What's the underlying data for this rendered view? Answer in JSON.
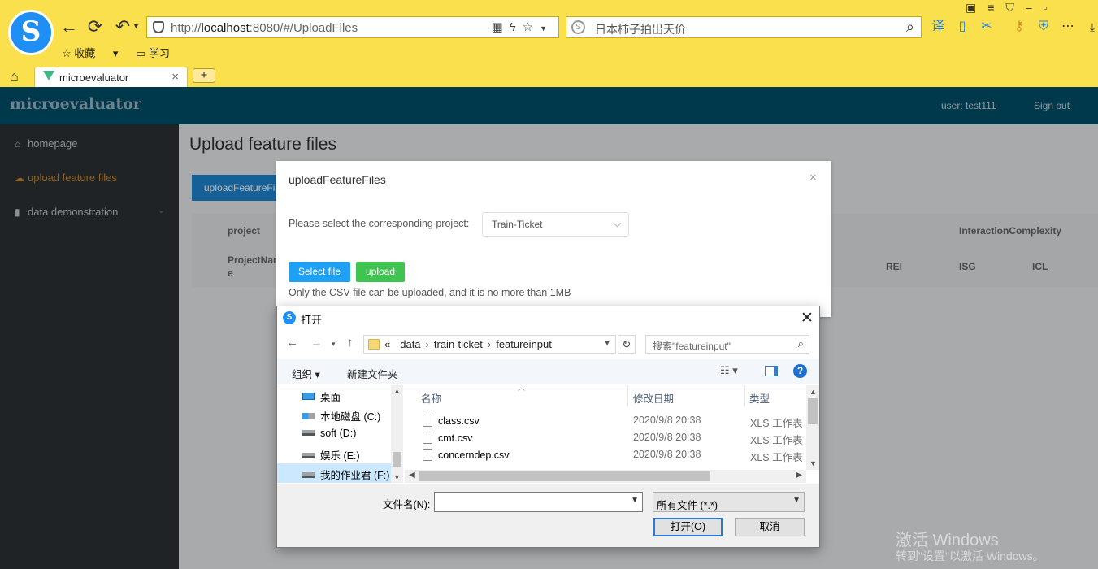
{
  "browser": {
    "url_prefix": "http://",
    "url_host": "localhost",
    "url_rest": ":8080/#/UploadFiles",
    "search_text": "日本柿子拍出天价",
    "bookmarks": [
      "收藏",
      "学习"
    ],
    "tab_title": "microevaluator",
    "new_tab": "+"
  },
  "app": {
    "brand": "microevaluator",
    "user_label": "user:  test111",
    "signout": "Sign out",
    "menu": [
      {
        "label": "homepage",
        "icon": "home-icon"
      },
      {
        "label": "upload feature files",
        "icon": "cloud-upload-icon",
        "active": true
      },
      {
        "label": "data demonstration",
        "icon": "bar-chart-icon"
      }
    ],
    "page_title": "Upload feature files",
    "upload_button": "uploadFeatureFiles",
    "table": {
      "group_headers": [
        "project",
        "InteractionComplexity"
      ],
      "column_headers": [
        "ProjectNam",
        "e",
        "REI",
        "ISG",
        "ICL"
      ]
    }
  },
  "dialog": {
    "title": "uploadFeatureFiles",
    "close": "×",
    "project_label": "Please select the corresponding project:",
    "project_value": "Train-Ticket",
    "select_file": "Select file",
    "upload": "upload",
    "tip": "Only the CSV file can be uploaded, and it is no more than 1MB"
  },
  "file_dialog": {
    "title": "打开",
    "path": [
      "data",
      "train-ticket",
      "featureinput"
    ],
    "path_prefix": "«",
    "search_placeholder": "搜索\"featureinput\"",
    "organize": "组织 ▾",
    "new_folder": "新建文件夹",
    "tree": [
      {
        "label": "桌面",
        "icon": "desktop-icon"
      },
      {
        "label": "本地磁盘 (C:)",
        "icon": "windows-drive-icon"
      },
      {
        "label": "soft (D:)",
        "icon": "drive-icon"
      },
      {
        "label": "娱乐 (E:)",
        "icon": "drive-icon"
      },
      {
        "label": "我的作业君 (F:)",
        "icon": "drive-icon",
        "selected": true
      }
    ],
    "columns": {
      "name": "名称",
      "date": "修改日期",
      "type": "类型"
    },
    "files": [
      {
        "name": "class.csv",
        "date": "2020/9/8 20:38",
        "type": "XLS 工作表"
      },
      {
        "name": "cmt.csv",
        "date": "2020/9/8 20:38",
        "type": "XLS 工作表"
      },
      {
        "name": "concerndep.csv",
        "date": "2020/9/8 20:38",
        "type": "XLS 工作表"
      }
    ],
    "filename_label": "文件名(N):",
    "filename_value": "",
    "filetype": "所有文件 (*.*)",
    "open": "打开(O)",
    "cancel": "取消"
  },
  "watermark": {
    "line1": "激活 Windows",
    "line2": "转到\"设置\"以激活 Windows。"
  }
}
